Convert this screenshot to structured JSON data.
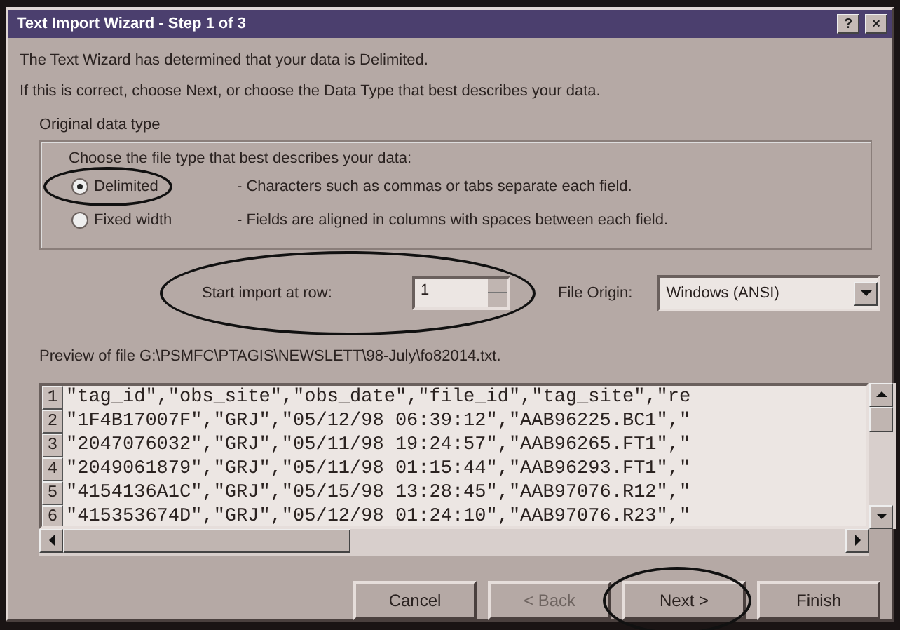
{
  "window": {
    "title": "Text Import Wizard - Step 1 of 3",
    "title_buttons": [
      "?",
      "×"
    ]
  },
  "intro": [
    "The Text Wizard has determined that your data is Delimited.",
    "If this is correct, choose Next, or choose the Data Type that best describes your data."
  ],
  "group": {
    "title": "Original data type",
    "prompt": "Choose the file type that best describes your data:",
    "options": [
      {
        "label": "Delimited",
        "description": "- Characters such as commas or tabs separate each field.",
        "selected": true,
        "circled": true
      },
      {
        "label": "Fixed width",
        "description": "- Fields are aligned in columns with spaces between each field.",
        "selected": false,
        "circled": false
      }
    ]
  },
  "start_row": {
    "label": "Start import at row:",
    "value": "1",
    "circled": true
  },
  "file_origin": {
    "label": "File Origin:",
    "value": "Windows (ANSI)"
  },
  "preview": {
    "label": "Preview of file G:\\PSMFC\\PTAGIS\\NEWSLETT\\98-July\\fo82014.txt.",
    "rows": [
      {
        "number": "1",
        "text": "\"tag_id\",\"obs_site\",\"obs_date\",\"file_id\",\"tag_site\",\"re"
      },
      {
        "number": "2",
        "text": "\"1F4B17007F\",\"GRJ\",\"05/12/98 06:39:12\",\"AAB96225.BC1\",\""
      },
      {
        "number": "3",
        "text": "\"2047076032\",\"GRJ\",\"05/11/98 19:24:57\",\"AAB96265.FT1\",\""
      },
      {
        "number": "4",
        "text": "\"2049061879\",\"GRJ\",\"05/11/98 01:15:44\",\"AAB96293.FT1\",\""
      },
      {
        "number": "5",
        "text": "\"4154136A1C\",\"GRJ\",\"05/15/98 13:28:45\",\"AAB97076.R12\",\""
      },
      {
        "number": "6",
        "text": "\"415353674D\",\"GRJ\",\"05/12/98 01:24:10\",\"AAB97076.R23\",\""
      }
    ]
  },
  "buttons": [
    {
      "label": "Cancel",
      "disabled": false,
      "circled": false
    },
    {
      "label": "< Back",
      "disabled": true,
      "circled": false
    },
    {
      "label": "Next >",
      "disabled": false,
      "circled": true
    },
    {
      "label": "Finish",
      "disabled": false,
      "circled": false
    }
  ]
}
